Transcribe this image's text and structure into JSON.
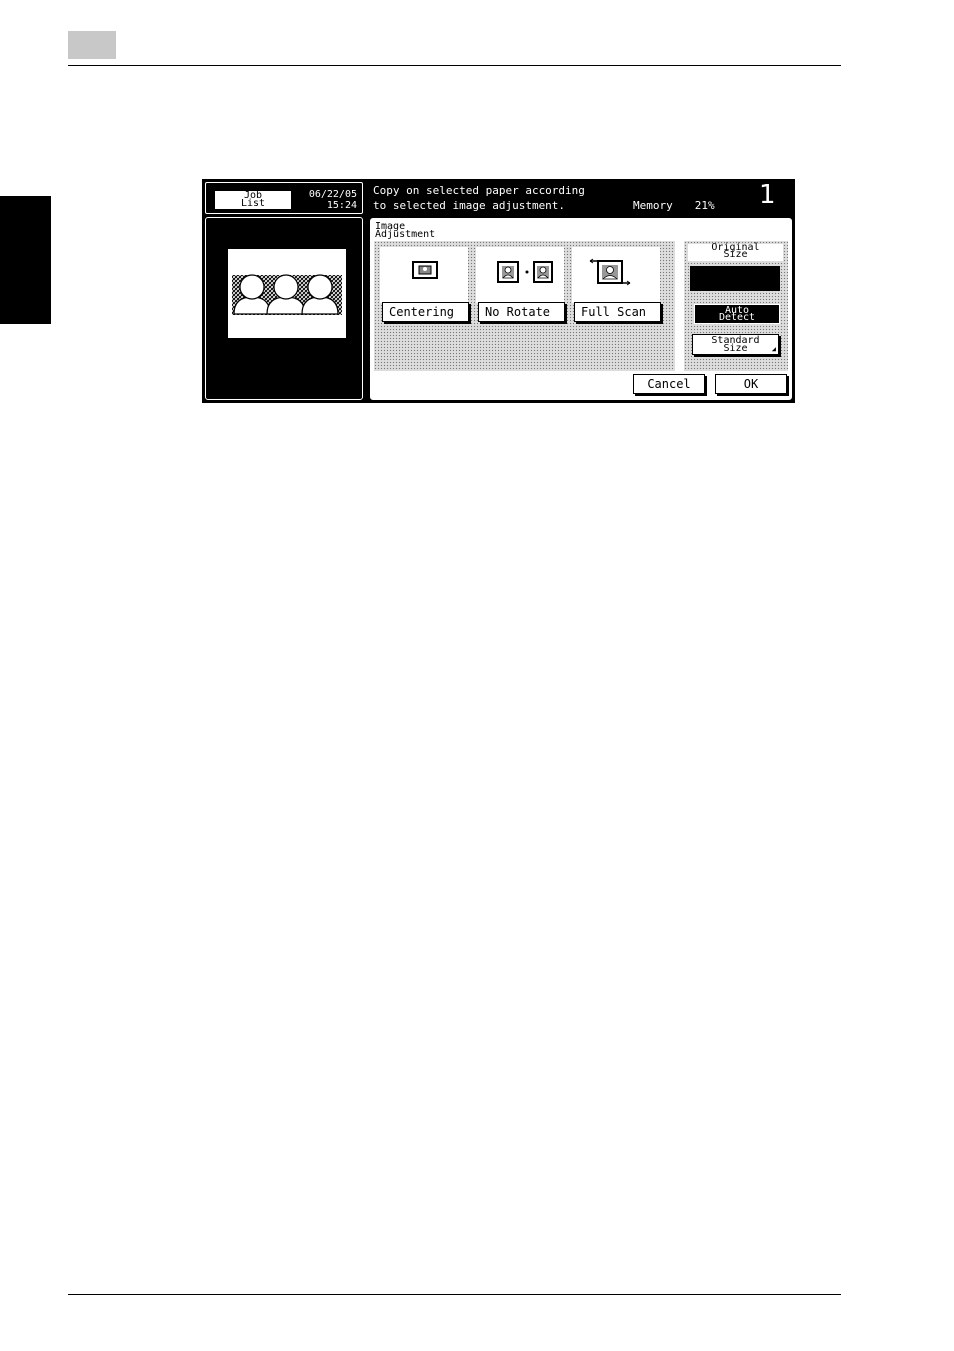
{
  "header": {
    "job_list_line1": "Job",
    "job_list_line2": "List",
    "date": "06/22/05",
    "time": "15:24",
    "message_line1": "Copy on selected paper according",
    "message_line2": "to selected image adjustment.",
    "memory_label": "Memory",
    "memory_value": "21%",
    "copy_count": "1"
  },
  "panel": {
    "title_line1": "Image",
    "title_line2": "Adjustment",
    "options": [
      {
        "label": "Centering",
        "icon": "centering-icon"
      },
      {
        "label": "No Rotate",
        "icon": "no-rotate-icon"
      },
      {
        "label": "Full Scan",
        "icon": "full-scan-icon"
      }
    ]
  },
  "original_size": {
    "title_line1": "Original",
    "title_line2": "Size",
    "auto_line1": "Auto",
    "auto_line2": "Detect",
    "standard_line1": "Standard",
    "standard_line2": "Size"
  },
  "actions": {
    "cancel": "Cancel",
    "ok": "OK"
  },
  "colors": {
    "screen_bg": "#000000",
    "panel_bg": "#ffffff",
    "page_tab": "#c8c8c8"
  }
}
